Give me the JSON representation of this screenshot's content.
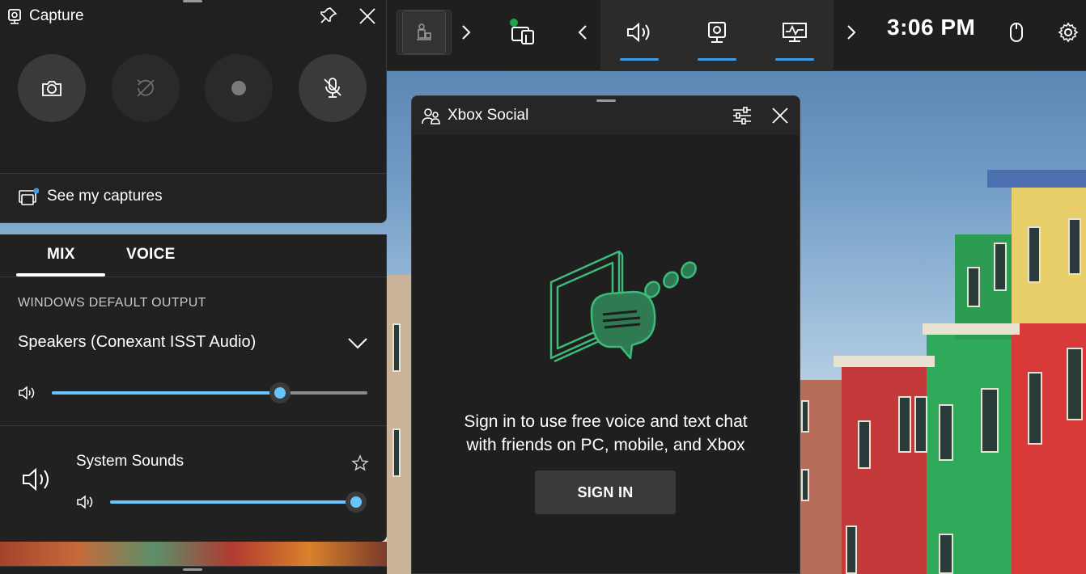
{
  "capture": {
    "title": "Capture",
    "see_captures_label": "See my captures",
    "buttons": [
      "screenshot-icon",
      "record-last-icon",
      "record-icon",
      "mic-icon"
    ]
  },
  "audio": {
    "tabs": [
      {
        "label": "MIX",
        "selected": true
      },
      {
        "label": "VOICE",
        "selected": false
      }
    ],
    "output_section_label": "WINDOWS DEFAULT OUTPUT",
    "output_device": "Speakers (Conexant ISST Audio)",
    "output_volume": 0.72,
    "apps": [
      {
        "name": "System Sounds",
        "volume": 1.0
      }
    ]
  },
  "gamebar": {
    "time": "3:06 PM",
    "accent": "#3c9de6"
  },
  "social": {
    "title": "Xbox Social",
    "message_line1": "Sign in to use free voice and text chat",
    "message_line2": "with friends on PC, mobile, and Xbox",
    "signin_label": "SIGN IN",
    "illustration_color": "#3dbb78"
  }
}
